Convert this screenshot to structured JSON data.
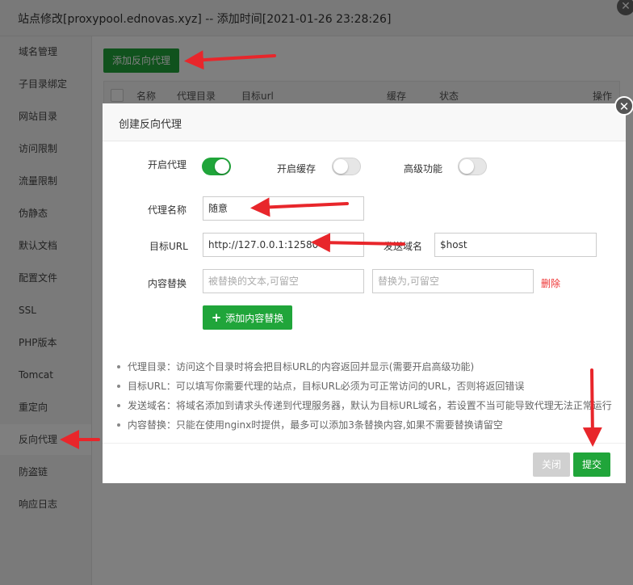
{
  "window": {
    "title": "站点修改[proxypool.ednovas.xyz] -- 添加时间[2021-01-26 23:28:26]",
    "close_icon": "close-icon"
  },
  "sidebar": {
    "items": [
      {
        "label": "域名管理"
      },
      {
        "label": "子目录绑定"
      },
      {
        "label": "网站目录"
      },
      {
        "label": "访问限制"
      },
      {
        "label": "流量限制"
      },
      {
        "label": "伪静态"
      },
      {
        "label": "默认文档"
      },
      {
        "label": "配置文件"
      },
      {
        "label": "SSL"
      },
      {
        "label": "PHP版本"
      },
      {
        "label": "Tomcat"
      },
      {
        "label": "重定向"
      },
      {
        "label": "反向代理"
      },
      {
        "label": "防盗链"
      },
      {
        "label": "响应日志"
      }
    ],
    "active": "反向代理"
  },
  "main": {
    "add_button": "添加反向代理",
    "table": {
      "columns": [
        "名称",
        "代理目录",
        "目标url",
        "缓存",
        "状态",
        "操作"
      ]
    }
  },
  "modal": {
    "title": "创建反向代理",
    "toggles": {
      "enable_proxy": {
        "label": "开启代理",
        "on": true
      },
      "enable_cache": {
        "label": "开启缓存",
        "on": false
      },
      "advanced": {
        "label": "高级功能",
        "on": false
      }
    },
    "proxy_name": {
      "label": "代理名称",
      "value": "随意"
    },
    "target_url": {
      "label": "目标URL",
      "value": "http://127.0.0.1:12580"
    },
    "send_domain": {
      "label": "发送域名",
      "value": "$host"
    },
    "content_replace": {
      "label": "内容替换",
      "from_placeholder": "被替换的文本,可留空",
      "to_placeholder": "替换为,可留空",
      "delete": "删除"
    },
    "add_replace_button": "添加内容替换",
    "tips": [
      "代理目录：访问这个目录时将会把目标URL的内容返回并显示(需要开启高级功能)",
      "目标URL：可以填写你需要代理的站点，目标URL必须为可正常访问的URL，否则将返回错误",
      "发送域名：将域名添加到请求头传递到代理服务器，默认为目标URL域名，若设置不当可能导致代理无法正常运行",
      "内容替换：只能在使用nginx时提供，最多可以添加3条替换内容,如果不需要替换请留空"
    ],
    "footer": {
      "close": "关闭",
      "submit": "提交"
    }
  },
  "colors": {
    "primary_green": "#20a53a",
    "annotation_red": "#e8262b",
    "delete_red": "#ee3333"
  }
}
